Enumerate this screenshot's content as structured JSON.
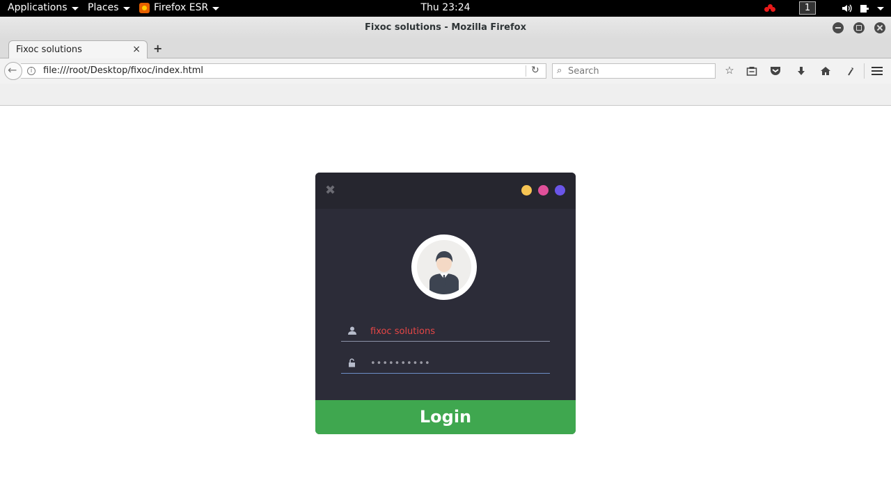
{
  "topbar": {
    "applications": "Applications",
    "places": "Places",
    "firefox_app": "Firefox ESR",
    "clock": "Thu 23:24",
    "workspace": "1"
  },
  "window": {
    "title": "Fixoc solutions - Mozilla Firefox"
  },
  "tab": {
    "label": "Fixoc solutions",
    "close": "×",
    "new": "+"
  },
  "nav": {
    "url": "file:///root/Desktop/fixoc/index.html",
    "search_placeholder": "Search"
  },
  "login": {
    "username_value": "fixoc solutions",
    "password_value": "••••••••••",
    "button_label": "Login",
    "dot_colors": [
      "#f6c453",
      "#e0509a",
      "#6a55e8"
    ]
  }
}
